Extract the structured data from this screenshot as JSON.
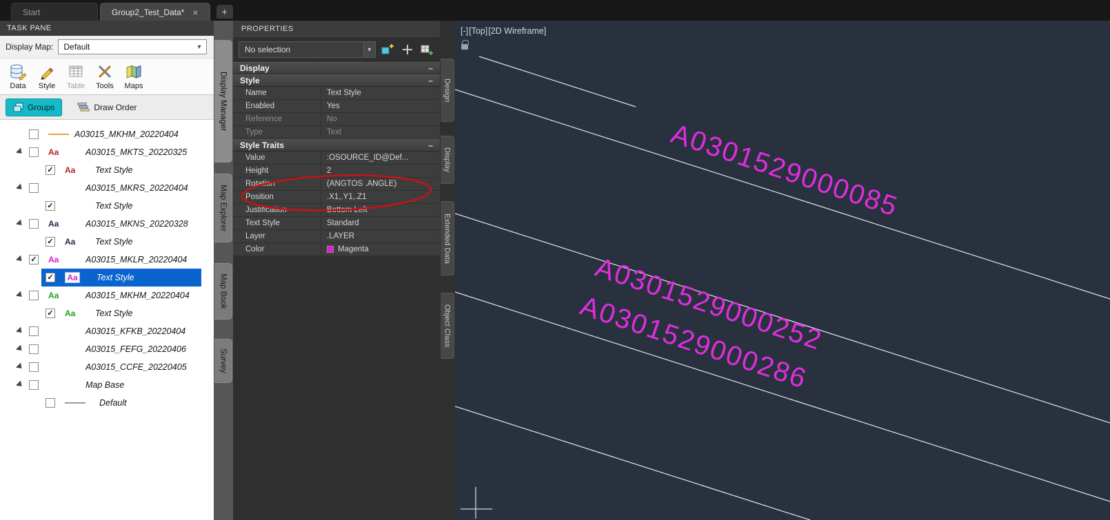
{
  "file_tabs": {
    "tabs": [
      {
        "label": "Start"
      },
      {
        "label": "Group2_Test_Data*"
      }
    ],
    "close_glyph": "×",
    "new_tab_glyph": "+"
  },
  "task_pane": {
    "title": "TASK PANE",
    "display_map_label": "Display Map:",
    "display_map_value": "Default",
    "toolbar": [
      {
        "label": "Data"
      },
      {
        "label": "Style"
      },
      {
        "label": "Table"
      },
      {
        "label": "Tools"
      },
      {
        "label": "Maps"
      }
    ],
    "groups_label": "Groups",
    "draw_order_label": "Draw Order",
    "aa_glyph": "Aa",
    "check_glyph": "✓",
    "tree": [
      {
        "label": "A03015_MKHM_20220404",
        "line_color": "#e2a23c",
        "checked": false
      },
      {
        "label": "A03015_MKTS_20220325",
        "aa_color": "#b42222",
        "checked": false
      },
      {
        "label": "Text Style",
        "aa_color": "#b42222",
        "checked": true
      },
      {
        "label": "A03015_MKRS_20220404",
        "checked": false
      },
      {
        "label": "Text Style",
        "checked": true
      },
      {
        "label": "A03015_MKNS_20220328",
        "aa_color": "#26264a",
        "checked": false
      },
      {
        "label": "Text Style",
        "aa_color": "#26264a",
        "checked": true
      },
      {
        "label": "A03015_MKLR_20220404",
        "aa_color": "#cf25cf",
        "checked": true
      },
      {
        "label": "Text Style",
        "aa_color": "#cf25cf",
        "checked": true,
        "selected": true
      },
      {
        "label": "A03015_MKHM_20220404",
        "aa_color": "#1da11d",
        "checked": false
      },
      {
        "label": "Text Style",
        "aa_color": "#1da11d",
        "checked": true
      },
      {
        "label": "A03015_KFKB_20220404",
        "checked": false
      },
      {
        "label": "A03015_FEFG_20220406",
        "checked": false
      },
      {
        "label": "A03015_CCFE_20220405",
        "checked": false
      },
      {
        "label": "Map Base",
        "checked": false
      },
      {
        "label": "Default",
        "line_color": "#9a9a9a",
        "checked": false
      }
    ]
  },
  "left_tabs": [
    "Display Manager",
    "Map Explorer",
    "Map Book",
    "Survey"
  ],
  "right_tabs": [
    "Design",
    "Display",
    "Extended Data",
    "Object Class"
  ],
  "properties": {
    "title": "PROPERTIES",
    "selector_value": "No selection",
    "collapse_glyph": "–",
    "sections": {
      "display": "Display",
      "style": "Style",
      "style_traits": "Style Traits"
    },
    "style_rows": [
      {
        "key": "Name",
        "value": "Text Style"
      },
      {
        "key": "Enabled",
        "value": "Yes"
      },
      {
        "key": "Reference",
        "value": "No"
      },
      {
        "key": "Type",
        "value": "Text"
      }
    ],
    "trait_rows": [
      {
        "key": "Value",
        "value": ":OSOURCE_ID@Def..."
      },
      {
        "key": "Height",
        "value": "2"
      },
      {
        "key": "Rotation",
        "value": "(ANGTOS .ANGLE)"
      },
      {
        "key": "Position",
        "value": ".X1,.Y1,.Z1"
      },
      {
        "key": "Justification",
        "value": "Bottom Left"
      },
      {
        "key": "Text Style",
        "value": "Standard"
      },
      {
        "key": "Layer",
        "value": ".LAYER"
      },
      {
        "key": "Color",
        "value": "Magenta"
      }
    ],
    "color_swatch": "#e515e5",
    "annotation_color": "#c41414"
  },
  "viewport": {
    "controls": [
      "[-]",
      "[Top]",
      "[2D Wireframe]"
    ],
    "background": "#28313d",
    "line_color": "#e2e6ea",
    "label_color": "#de2ede",
    "labels": [
      {
        "text": "A0301529000085"
      },
      {
        "text": "A0301529000252"
      },
      {
        "text": "A0301529000286"
      }
    ],
    "lines": [
      [
        35,
        52,
        262,
        125
      ],
      [
        0,
        100,
        950,
        404
      ],
      [
        0,
        280,
        950,
        584
      ],
      [
        0,
        394,
        950,
        698
      ],
      [
        0,
        560,
        515,
        725
      ]
    ]
  }
}
